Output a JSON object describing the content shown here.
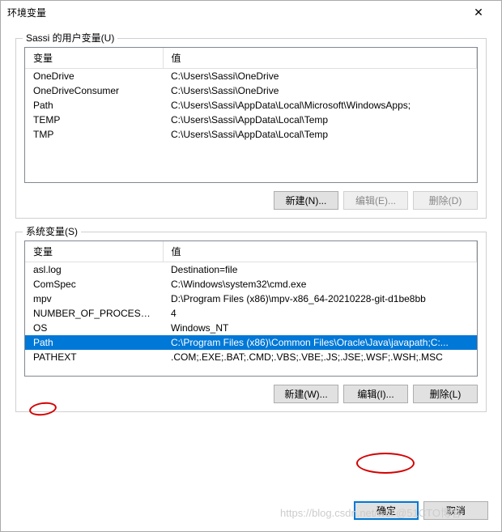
{
  "window": {
    "title": "环境变量",
    "close": "✕"
  },
  "userVars": {
    "legend": "Sassi 的用户变量(U)",
    "headers": {
      "name": "变量",
      "value": "值"
    },
    "rows": [
      {
        "name": "OneDrive",
        "value": "C:\\Users\\Sassi\\OneDrive"
      },
      {
        "name": "OneDriveConsumer",
        "value": "C:\\Users\\Sassi\\OneDrive"
      },
      {
        "name": "Path",
        "value": "C:\\Users\\Sassi\\AppData\\Local\\Microsoft\\WindowsApps;"
      },
      {
        "name": "TEMP",
        "value": "C:\\Users\\Sassi\\AppData\\Local\\Temp"
      },
      {
        "name": "TMP",
        "value": "C:\\Users\\Sassi\\AppData\\Local\\Temp"
      }
    ],
    "buttons": {
      "new": "新建(N)...",
      "edit": "编辑(E)...",
      "delete": "删除(D)"
    }
  },
  "sysVars": {
    "legend": "系统变量(S)",
    "headers": {
      "name": "变量",
      "value": "值"
    },
    "rows": [
      {
        "name": "asl.log",
        "value": "Destination=file"
      },
      {
        "name": "ComSpec",
        "value": "C:\\Windows\\system32\\cmd.exe"
      },
      {
        "name": "mpv",
        "value": "D:\\Program Files (x86)\\mpv-x86_64-20210228-git-d1be8bb"
      },
      {
        "name": "NUMBER_OF_PROCESSORS",
        "value": "4"
      },
      {
        "name": "OS",
        "value": "Windows_NT"
      },
      {
        "name": "Path",
        "value": "C:\\Program Files (x86)\\Common Files\\Oracle\\Java\\javapath;C:..."
      },
      {
        "name": "PATHEXT",
        "value": ".COM;.EXE;.BAT;.CMD;.VBS;.VBE;.JS;.JSE;.WSF;.WSH;.MSC"
      }
    ],
    "selectedIndex": 5,
    "buttons": {
      "new": "新建(W)...",
      "edit": "编辑(I)...",
      "delete": "删除(L)"
    }
  },
  "footer": {
    "ok": "确定",
    "cancel": "取消"
  },
  "watermark": "https://blog.csdn.net/wei  @51CTO博客"
}
